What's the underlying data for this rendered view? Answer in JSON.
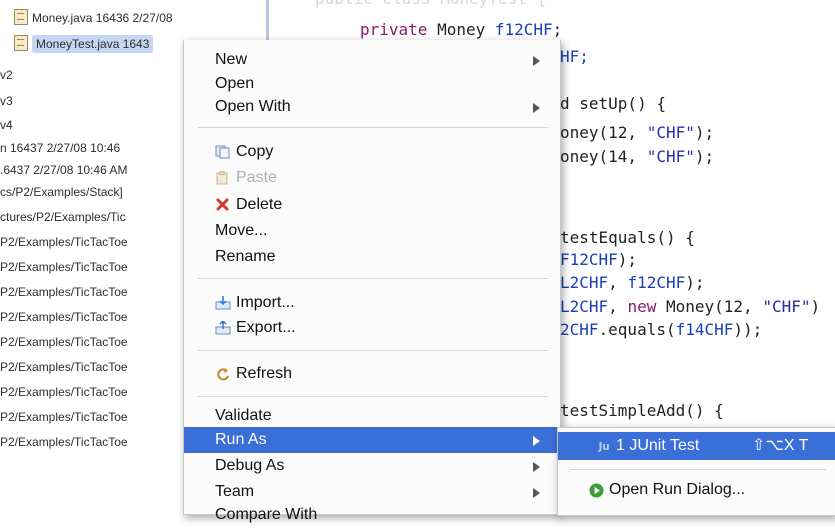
{
  "explorer": {
    "rows": [
      {
        "text": "Money.java 16436  2/27/08"
      },
      {
        "text": "MoneyTest.java 1643"
      },
      {
        "text": "v2"
      },
      {
        "text": "v3"
      },
      {
        "text": "v4"
      },
      {
        "text": "n 16437  2/27/08 10:46"
      },
      {
        "text": ".6437  2/27/08 10:46 AM"
      },
      {
        "text": "cs/P2/Examples/Stack]"
      },
      {
        "text": "ctures/P2/Examples/Tic"
      },
      {
        "text": "P2/Examples/TicTacToe"
      },
      {
        "text": "P2/Examples/TicTacToe"
      },
      {
        "text": "P2/Examples/TicTacToe"
      },
      {
        "text": "P2/Examples/TicTacToe"
      },
      {
        "text": "P2/Examples/TicTacToe"
      },
      {
        "text": "P2/Examples/TicTacToe"
      },
      {
        "text": "P2/Examples/TicTacToe"
      },
      {
        "text": "P2/Examples/TicTacToe"
      },
      {
        "text": "P2/Examples/TicTacToe"
      }
    ]
  },
  "editor": {
    "line1_kw": "private",
    "line1_type": " Money ",
    "line1_field": "f12CHF",
    "line1_end": ";",
    "line2": "HF;",
    "line3": "d setUp() {",
    "line4_a": "oney(12, ",
    "line4_str": "\"CHF\"",
    "line4_b": ");",
    "line5_a": "oney(14, ",
    "line5_str": "\"CHF\"",
    "line5_b": ");",
    "line6": "testEquals() {",
    "line7_field": "F12CHF",
    "line7_b": ");",
    "line8_field": "L2CHF",
    "line8_b": ", ",
    "line8_field2": "f12CHF",
    "line8_c": ");",
    "line9_field": "L2CHF",
    "line9_b": ", ",
    "line9_new": "new",
    "line9_c": " Money(12, ",
    "line9_str": "\"CHF\"",
    "line9_d": ")",
    "line10_field": "2CHF",
    "line10_b": ".equals(",
    "line10_field2": "f14CHF",
    "line10_c": "));",
    "line11": "testSimpleAdd() {"
  },
  "context_menu": {
    "items": [
      {
        "label": "New"
      },
      {
        "label": "Open"
      },
      {
        "label": "Open With"
      },
      {
        "label": "Copy"
      },
      {
        "label": "Paste"
      },
      {
        "label": "Delete"
      },
      {
        "label": "Move..."
      },
      {
        "label": "Rename"
      },
      {
        "label": "Import..."
      },
      {
        "label": "Export..."
      },
      {
        "label": "Refresh"
      },
      {
        "label": "Validate"
      },
      {
        "label": "Run As"
      },
      {
        "label": "Debug As"
      },
      {
        "label": "Team"
      },
      {
        "label": "Compare With"
      }
    ]
  },
  "submenu": {
    "junit_label": "1 JUnit Test",
    "junit_shortcut": "⇧⌥X T",
    "run_dialog_label": "Open Run Dialog..."
  },
  "colors": {
    "highlight": "#3a6fd8",
    "keyword": "#8b1a6b",
    "field": "#1a3fb8"
  }
}
